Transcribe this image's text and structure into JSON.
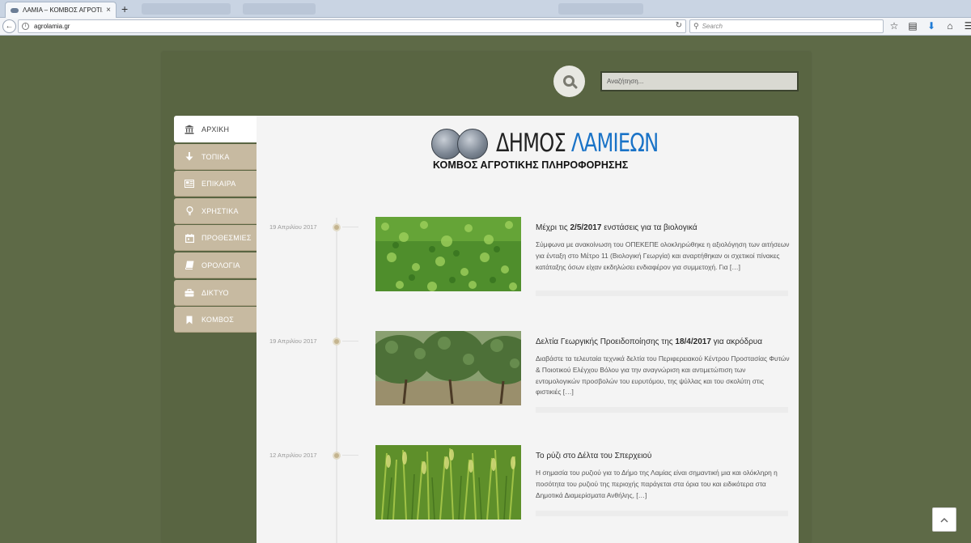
{
  "browser": {
    "tab_title": "ΛΑΜΙΑ – ΚΟΜΒΟΣ ΑΓΡΟΤΙ...",
    "tab_close": "×",
    "new_tab": "+",
    "url": "agrolamia.gr",
    "search_placeholder": "Search"
  },
  "site": {
    "search_placeholder": "Αναζήτηση...",
    "logo_line1_a": "ΔΗΜΟΣ",
    "logo_line1_b": "ΛΑΜΙΕΩΝ",
    "logo_line2": "ΚΟΜΒΟΣ ΑΓΡΟΤΙΚΗΣ ΠΛΗΡΟΦΟΡΗΣΗΣ"
  },
  "menu": [
    {
      "label": "ΑΡΧΙΚΗ",
      "icon": "bank-icon"
    },
    {
      "label": "ΤΟΠΙΚΑ",
      "icon": "arrow-down-icon"
    },
    {
      "label": "ΕΠΙΚΑΙΡΑ",
      "icon": "newspaper-icon"
    },
    {
      "label": "ΧΡΗΣΤΙΚΑ",
      "icon": "lightbulb-icon"
    },
    {
      "label": "ΠΡΟΘΕΣΜΙΕΣ",
      "icon": "calendar-icon"
    },
    {
      "label": "ΟΡΟΛΟΓΙΑ",
      "icon": "book-icon"
    },
    {
      "label": "ΔΙΚΤΥΟ",
      "icon": "briefcase-icon"
    },
    {
      "label": "ΚΟΜΒΟΣ",
      "icon": "bookmark-icon"
    }
  ],
  "posts": [
    {
      "date": "19 Απριλίου 2017",
      "title_a": "Μέχρι τις ",
      "title_b": "2/5/2017",
      "title_c": " ενστάσεις για τα βιολογικά",
      "excerpt": "Σύμφωνα με ανακοίνωση του ΟΠΕΚΕΠΕ ολοκληρώθηκε η αξιολόγηση των αιτήσεων για ένταξη στο Μέτρο 11 (Βιολογική Γεωργία) και αναρτήθηκαν οι σχετικοί πίνακες κατάταξης όσων είχαν εκδηλώσει ενδιαφέρον για συμμετοχή. Για […]"
    },
    {
      "date": "19 Απριλίου 2017",
      "title_a": "Δελτία Γεωργικής Προειδοποίησης της ",
      "title_b": "18/4/2017",
      "title_c": " για ακρόδρυα",
      "excerpt": "Διαβάστε τα τελευταία τεχνικά δελτία του Περιφερειακού Κέντρου Προστασίας Φυτών & Ποιοτικού Ελέγχου Βόλου για την αναγνώριση και αντιμετώπιση των εντομολογικών προσβολών του ευρυτόμου, της ψύλλας και του σκολύτη στις φιστικιές […]"
    },
    {
      "date": "12 Απριλίου 2017",
      "title_a": "Το ρύζι στο Δέλτα του Σπερχειού",
      "title_b": "",
      "title_c": "",
      "excerpt": "Η σημασία του ρυζιού για το Δήμο της Λαμίας είναι σημαντική μια και ολόκληρη η ποσότητα του ρυζιού της περιοχής παράγεται στα όρια του και ειδικότερα στα Δημοτικά Διαμερίσματα Ανθήλης, […]"
    }
  ],
  "colors": {
    "page_bg": "#5e6a47",
    "menu_bg": "#c7baa1",
    "logo_blue": "#1a73c7",
    "timeline_dot": "#c4b48f"
  }
}
